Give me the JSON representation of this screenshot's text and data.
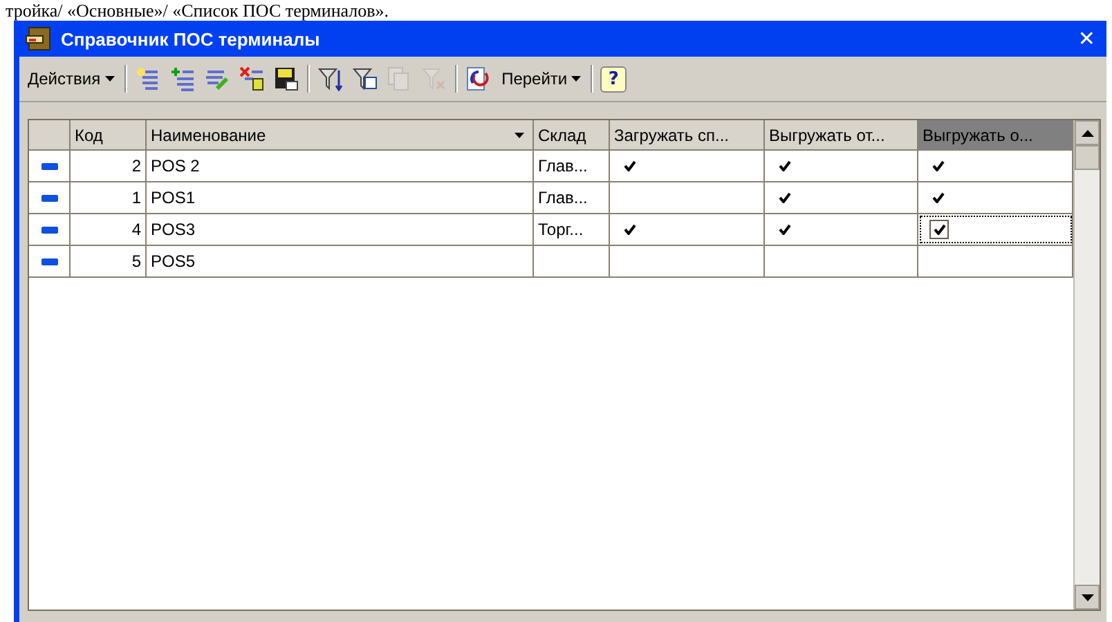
{
  "caption_fragment": "тройка/ «Основные»/ «Список ПОС терминалов».",
  "window": {
    "title": "Справочник ПОС терминалы",
    "close": "✕"
  },
  "toolbar": [
    {
      "kind": "menu",
      "label": "Действия",
      "disabled": false
    },
    {
      "kind": "separator"
    },
    {
      "kind": "icon",
      "disabled": false
    },
    {
      "kind": "icon",
      "disabled": false
    },
    {
      "kind": "icon",
      "disabled": false
    },
    {
      "kind": "icon",
      "disabled": false
    },
    {
      "kind": "icon",
      "disabled": false
    },
    {
      "kind": "separator"
    },
    {
      "kind": "icon",
      "disabled": false
    },
    {
      "kind": "icon",
      "disabled": false
    },
    {
      "kind": "icon",
      "disabled": true
    },
    {
      "kind": "icon",
      "disabled": true
    },
    {
      "kind": "separator"
    },
    {
      "kind": "icon",
      "disabled": false
    },
    {
      "kind": "menu",
      "label": "Перейти",
      "disabled": false
    },
    {
      "kind": "separator"
    },
    {
      "kind": "help",
      "label": "?",
      "disabled": false
    }
  ],
  "table": {
    "columns": [
      {
        "label": "Код",
        "sorted": false,
        "selected": false
      },
      {
        "label": "Наименование",
        "sorted": true,
        "selected": false
      },
      {
        "label": "Склад",
        "sorted": false,
        "selected": false
      },
      {
        "label": "Загружать сп...",
        "sorted": false,
        "selected": false
      },
      {
        "label": "Выгружать от...",
        "sorted": false,
        "selected": false
      },
      {
        "label": "Выгружать о...",
        "sorted": false,
        "selected": true
      }
    ],
    "rows": [
      {
        "code": "2",
        "name": "POS 2",
        "warehouse": "Глав...",
        "checks": [
          true,
          true,
          true
        ],
        "selected": false
      },
      {
        "code": "1",
        "name": "POS1",
        "warehouse": "Глав...",
        "checks": [
          false,
          true,
          true
        ],
        "selected": false
      },
      {
        "code": "4",
        "name": "POS3",
        "warehouse": "Торг...",
        "checks": [
          true,
          true,
          true
        ],
        "selected": true
      },
      {
        "code": "5",
        "name": "POS5",
        "warehouse": "",
        "checks": [
          false,
          false,
          false
        ],
        "selected": false
      }
    ]
  }
}
